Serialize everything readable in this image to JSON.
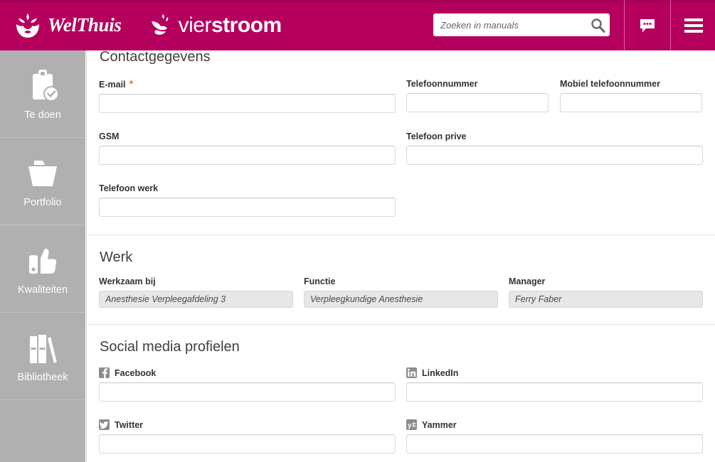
{
  "header": {
    "brand_primary": "WelThuis",
    "brand_secondary_light": "vier",
    "brand_secondary_bold": "stroom",
    "brand_secondary_tail": "oom",
    "search_placeholder": "Zoeken in manuals",
    "search_value": "",
    "search_icon": "search-icon",
    "chat_icon": "chat-bubble-icon",
    "menu_icon": "hamburger-menu-icon",
    "background_color": "#b5005e"
  },
  "sidebar": {
    "background_color": "#b0b0b0",
    "items": [
      {
        "label": "Te doen",
        "icon": "clipboard-check-icon"
      },
      {
        "label": "Portfolio",
        "icon": "folder-icon"
      },
      {
        "label": "Kwaliteiten",
        "icon": "thumbs-up-icon"
      },
      {
        "label": "Bibliotheek",
        "icon": "books-icon"
      }
    ]
  },
  "sections": {
    "contact": {
      "title": "Contactgegevens",
      "fields": {
        "email": {
          "label": "E-mail",
          "required_marker": "*",
          "value": "",
          "required_color": "#e8821e"
        },
        "telefoonnummer": {
          "label": "Telefoonnummer",
          "value": ""
        },
        "mobiel": {
          "label": "Mobiel telefoonnummer",
          "value": ""
        },
        "gsm": {
          "label": "GSM",
          "value": ""
        },
        "telefoon_prive": {
          "label": "Telefoon prive",
          "value": ""
        },
        "telefoon_werk": {
          "label": "Telefoon werk",
          "value": ""
        }
      }
    },
    "werk": {
      "title": "Werk",
      "fields": {
        "werkzaam_bij": {
          "label": "Werkzaam bij",
          "value": "Anesthesie Verpleegafdeling 3"
        },
        "functie": {
          "label": "Functie",
          "value": "Verpleegkundige Anesthesie"
        },
        "manager": {
          "label": "Manager",
          "value": "Ferry Faber"
        }
      }
    },
    "social": {
      "title": "Social media profielen",
      "fields": {
        "facebook": {
          "label": "Facebook",
          "icon": "facebook-icon",
          "value": ""
        },
        "linkedin": {
          "label": "LinkedIn",
          "icon": "linkedin-icon",
          "value": ""
        },
        "twitter": {
          "label": "Twitter",
          "icon": "twitter-icon",
          "value": ""
        },
        "yammer": {
          "label": "Yammer",
          "icon": "yammer-icon",
          "value": ""
        }
      }
    }
  }
}
